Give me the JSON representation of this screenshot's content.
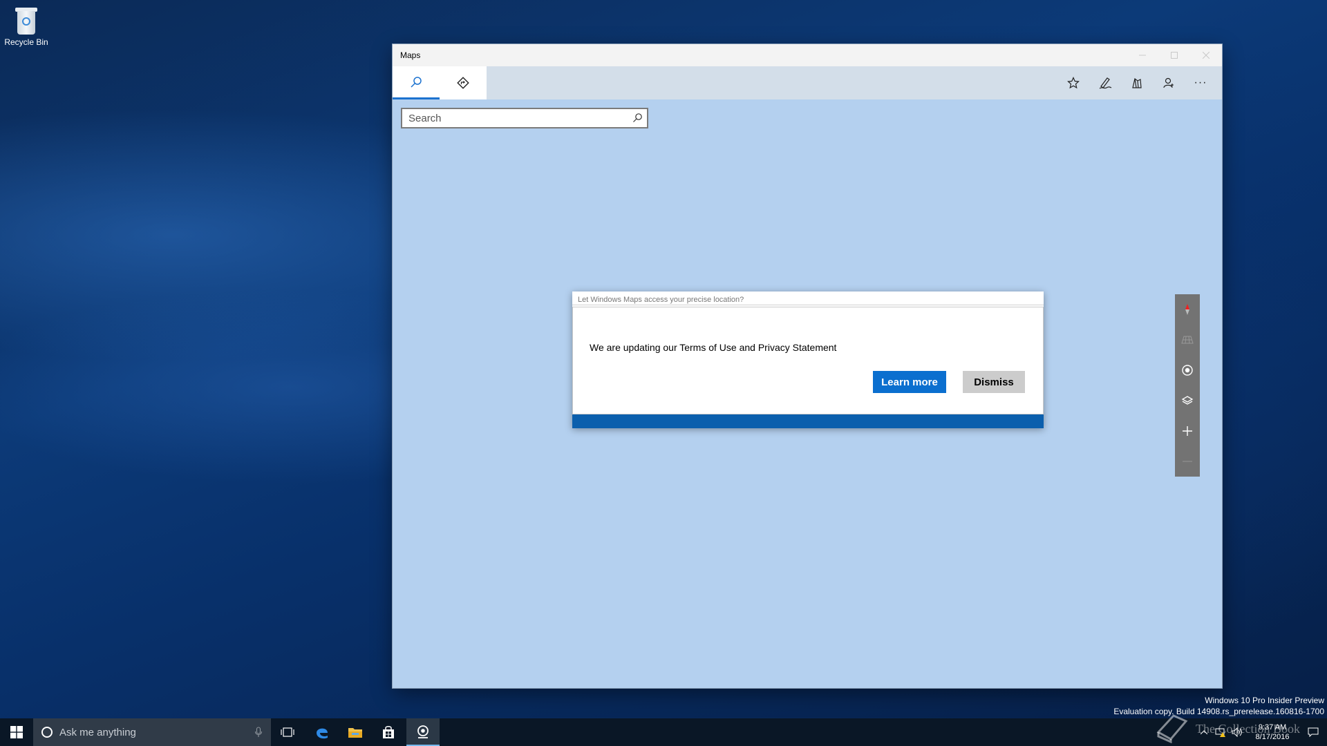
{
  "desktop": {
    "icons": [
      {
        "label": "Recycle Bin",
        "icon": "recycle-bin-icon"
      }
    ]
  },
  "window": {
    "title": "Maps",
    "tabs": [
      {
        "icon": "search-icon"
      },
      {
        "icon": "directions-icon"
      }
    ],
    "tools": [
      {
        "icon": "favorites-star-icon"
      },
      {
        "icon": "ink-pen-icon"
      },
      {
        "icon": "3d-cities-icon"
      },
      {
        "icon": "account-icon"
      },
      {
        "icon": "more-icon",
        "label": "···"
      }
    ],
    "search": {
      "placeholder": "Search"
    },
    "map_controls": [
      {
        "icon": "compass-icon"
      },
      {
        "icon": "tilt-icon"
      },
      {
        "icon": "locate-me-icon"
      },
      {
        "icon": "layers-icon"
      },
      {
        "icon": "zoom-in-icon"
      },
      {
        "icon": "zoom-out-icon"
      }
    ]
  },
  "dialog": {
    "background_title": "Let Windows Maps access your precise location?",
    "message": "We are updating our Terms of Use and Privacy Statement",
    "primary_label": "Learn more",
    "secondary_label": "Dismiss"
  },
  "watermark": {
    "line1": "Windows 10 Pro Insider Preview",
    "line2": "Evaluation copy. Build 14908.rs_prerelease.160816-1700",
    "brand": "The Collection Book"
  },
  "taskbar": {
    "search_placeholder": "Ask me anything",
    "pinned": [
      "task-view-icon",
      "edge-icon",
      "file-explorer-icon",
      "store-icon",
      "maps-icon"
    ],
    "time": "9:37 AM",
    "date": "8/17/2016"
  },
  "colors": {
    "accent": "#0b6fcf",
    "map_background": "#b4d0ef",
    "taskbar": "#0a1726"
  }
}
